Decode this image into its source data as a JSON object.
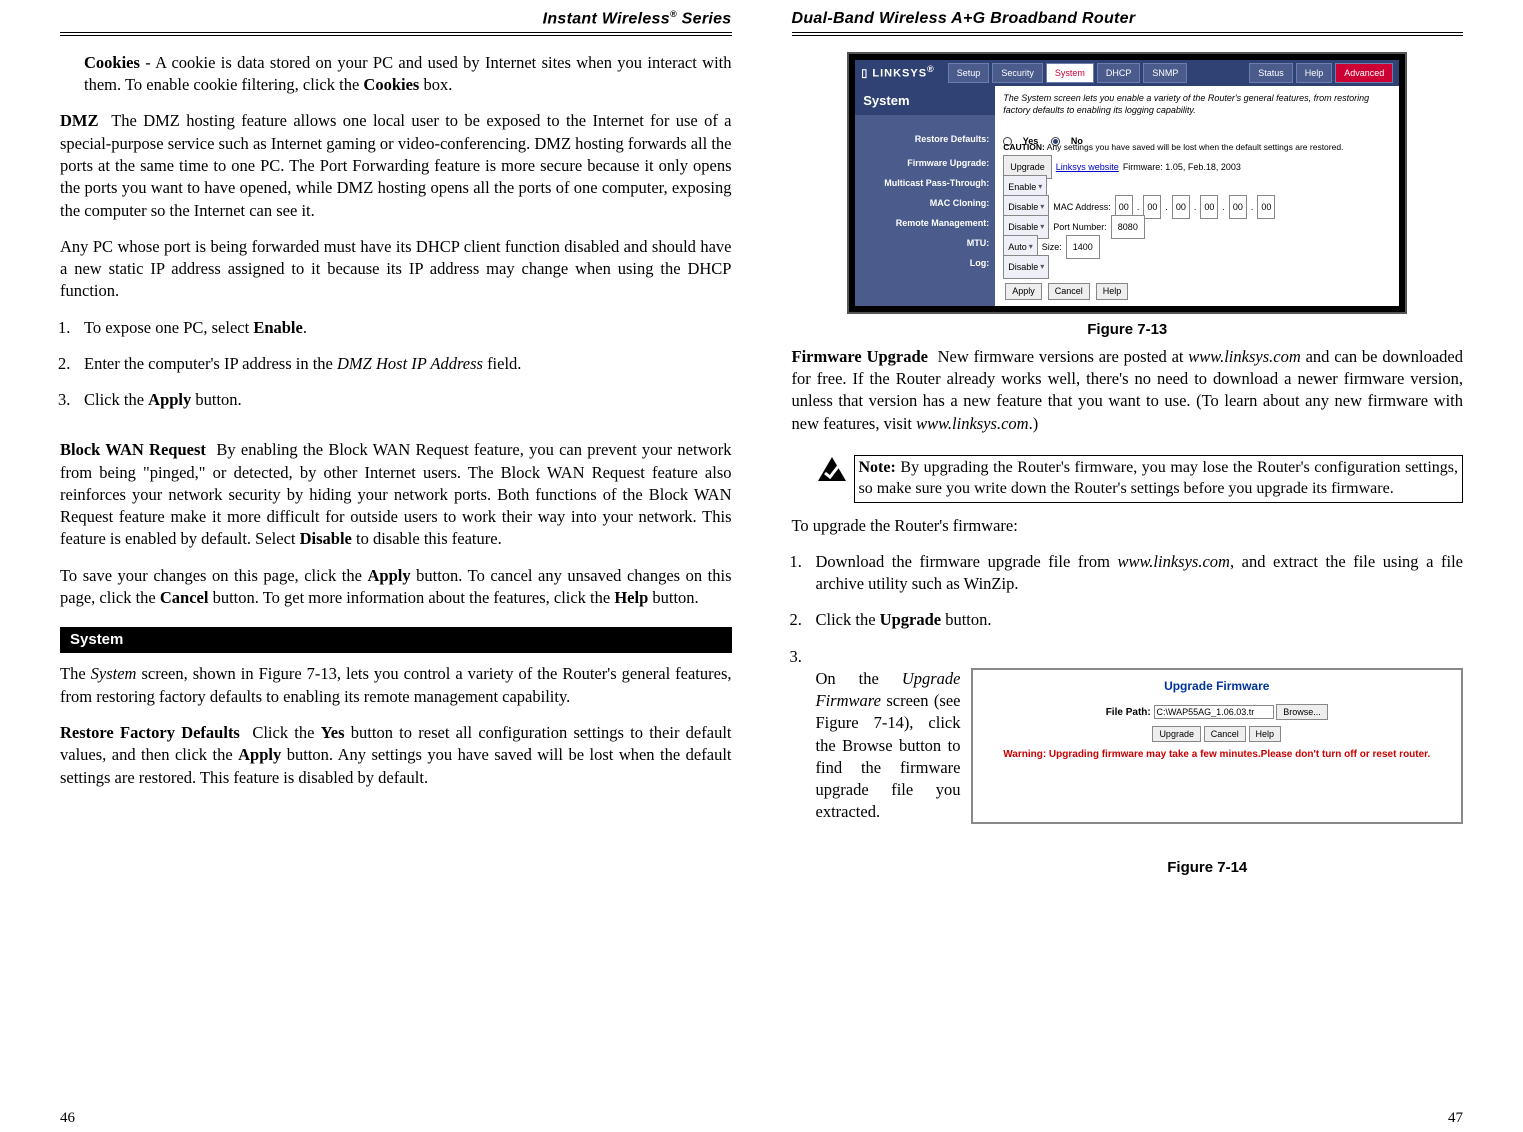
{
  "left": {
    "header": "Instant Wireless",
    "header_suffix": " Series",
    "cookies_para": "Cookies - A cookie is data stored on your PC and used by Internet sites when you interact with them. To enable cookie filtering, click the Cookies box.",
    "dmz_para": "DMZ  The DMZ hosting feature allows one local user to be exposed to the Internet for use of a special-purpose service such as Internet gaming or video-conferencing. DMZ hosting forwards all the ports at the same time to one PC. The Port Forwarding feature is more secure because it only opens the ports you want to have opened, while DMZ hosting opens all the ports of one computer, exposing the computer so the Internet can see it.",
    "dmz_para2": "Any PC whose port is being forwarded must have its DHCP client function disabled and should have a new static IP address assigned to it because its IP address may change when using the DHCP function.",
    "steps": {
      "s1": "To expose one PC, select Enable.",
      "s2": "Enter the computer's IP address in the DMZ Host IP Address field.",
      "s3": "Click the Apply button."
    },
    "block_wan": "Block WAN Request  By enabling the Block WAN Request feature, you can prevent your network from being \"pinged,\" or detected, by other Internet users. The Block WAN Request feature also reinforces your network security by hiding your network ports. Both functions of the Block WAN Request feature make it more difficult for outside users to work their way into your network. This feature is enabled by default. Select Disable to disable this feature.",
    "save_para": "To save your changes on this page, click the Apply button. To cancel any unsaved changes on this page, click the Cancel button. To get more information about the features, click the Help button.",
    "section": "System",
    "system_para": "The System screen, shown in Figure 7-13, lets you control a variety of the Router's general features, from restoring factory defaults to enabling its remote management capability.",
    "restore_para": "Restore Factory Defaults  Click the Yes button to reset all configuration settings to their default values, and then click the Apply button. Any settings you have saved will be lost when the default settings are restored. This feature is disabled by default.",
    "page_num": "46"
  },
  "right": {
    "header": "Dual-Band Wireless A+G Broadband Router",
    "fig713": "Figure 7-13",
    "fw_para": "Firmware Upgrade  New firmware versions are posted at www.linksys.com and can be downloaded for free. If the Router already works well, there's no need to download a newer firmware version, unless that version has a new feature that you want to use. (To learn about any new firmware with new features, visit www.linksys.com.)",
    "note": "Note: By upgrading the Router's firmware, you may lose the Router's configuration settings, so make sure you write down the Router's settings before you upgrade its firmware.",
    "upgrade_intro": "To upgrade the Router's firmware:",
    "steps": {
      "s1": "Download the firmware upgrade file from www.linksys.com, and extract the file using a file archive utility such as WinZip.",
      "s2": "Click the Upgrade button.",
      "s3": "On the Upgrade Firmware screen (see Figure 7-14), click the Browse button to find the firmware upgrade file you extracted."
    },
    "fig714": "Figure 7-14",
    "page_num": "47",
    "router": {
      "brand": "LINKSYS",
      "tabs": {
        "setup": "Setup",
        "security": "Security",
        "system": "System",
        "dhcp": "DHCP",
        "snmp": "SNMP",
        "status": "Status",
        "help": "Help",
        "advanced": "Advanced"
      },
      "title": "System",
      "desc": "The System screen lets you enable a variety of the Router's general features, from restoring factory defaults to enabling its logging capability.",
      "labels": {
        "restore": "Restore Defaults:",
        "fw": "Firmware Upgrade:",
        "mpt": "Multicast Pass-Through:",
        "mac": "MAC Cloning:",
        "remote": "Remote Management:",
        "mtu": "MTU:",
        "log": "Log:"
      },
      "vals": {
        "yes": "Yes",
        "no": "No",
        "caution": "CAUTION: Any settings you have saved will be lost when the default settings are restored.",
        "upgrade_btn": "Upgrade",
        "linksys": "Linksys website",
        "fw_ver": "Firmware: 1.05, Feb.18, 2003",
        "enable": "Enable",
        "disable": "Disable",
        "auto": "Auto",
        "mac_label": "MAC Address:",
        "mac": [
          "00",
          "00",
          "00",
          "00",
          "00",
          "00"
        ],
        "port_label": "Port Number:",
        "port": "8080",
        "size_label": "Size:",
        "size": "1400",
        "apply": "Apply",
        "cancel": "Cancel",
        "help": "Help"
      }
    },
    "upg": {
      "title": "Upgrade Firmware",
      "path_label": "File Path:",
      "path": "C:\\WAP55AG_1.06.03.tr",
      "browse": "Browse...",
      "upgrade": "Upgrade",
      "cancel": "Cancel",
      "help": "Help",
      "warn": "Warning: Upgrading firmware may take a few minutes.Please don't turn off or reset router."
    }
  }
}
